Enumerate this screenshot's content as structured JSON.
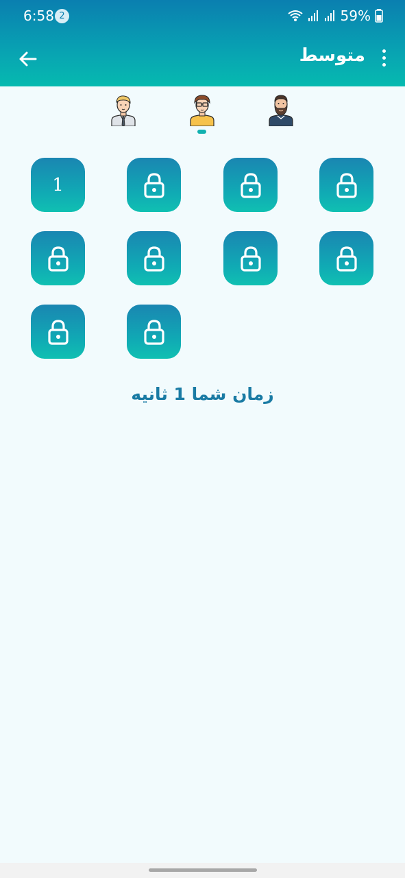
{
  "status_bar": {
    "time": "6:58",
    "notification_count": "2",
    "battery": "59%"
  },
  "toolbar": {
    "title": "متوسط"
  },
  "avatars": [
    {
      "name": "businessman"
    },
    {
      "name": "glasses-man",
      "selected": true
    },
    {
      "name": "bearded-man"
    }
  ],
  "levels": [
    {
      "label": "1",
      "locked": false
    },
    {
      "label": "",
      "locked": true
    },
    {
      "label": "",
      "locked": true
    },
    {
      "label": "",
      "locked": true
    },
    {
      "label": "",
      "locked": true
    },
    {
      "label": "",
      "locked": true
    },
    {
      "label": "",
      "locked": true
    },
    {
      "label": "",
      "locked": true
    },
    {
      "label": "",
      "locked": true
    },
    {
      "label": "",
      "locked": true
    }
  ],
  "result": {
    "time_text": "زمان شما 1 ثانیه"
  },
  "colors": {
    "accent": "#0a9fb2",
    "text": "#1a7ba4",
    "background": "#f2fbfd"
  }
}
